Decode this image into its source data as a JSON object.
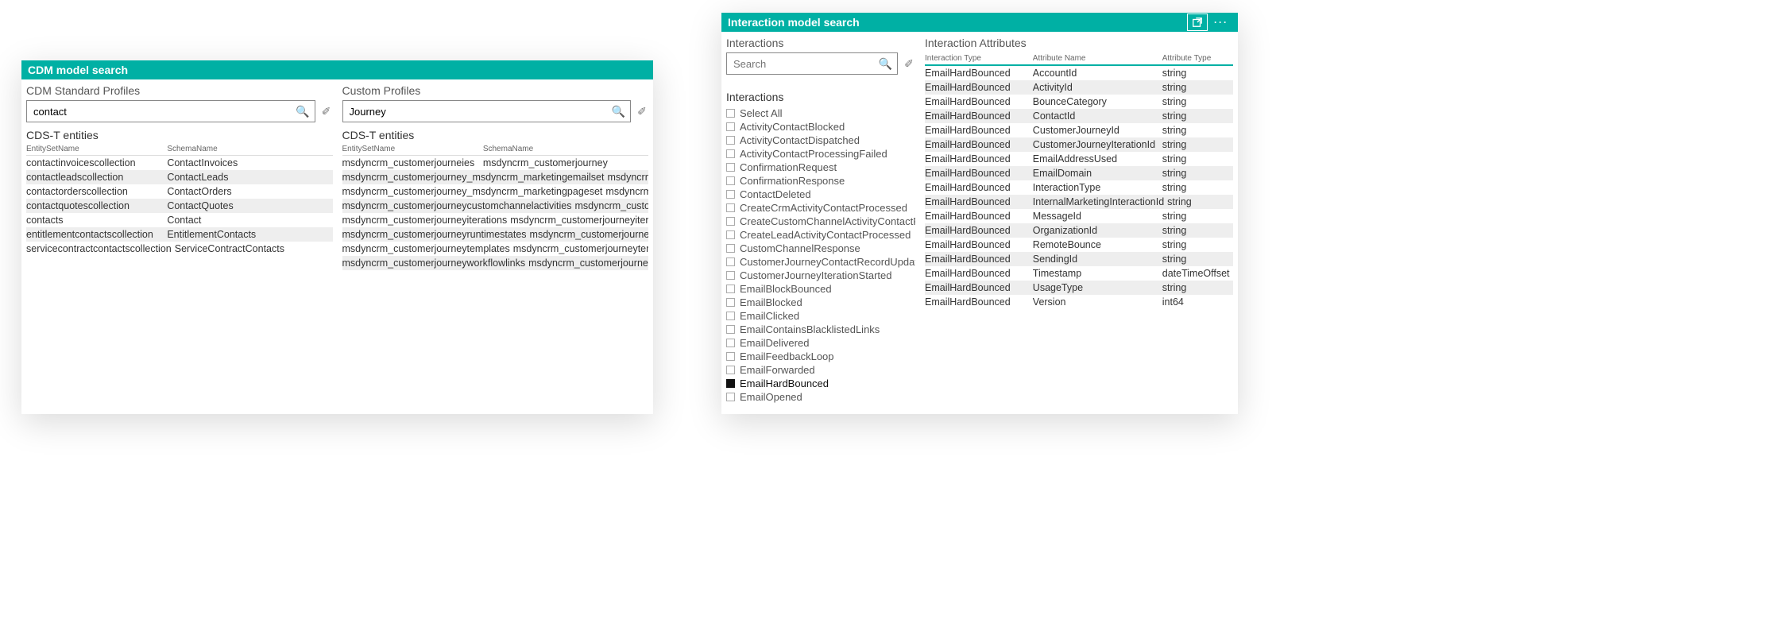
{
  "accent": "#00b0a4",
  "leftPanel": {
    "title": "CDM model search",
    "std": {
      "label": "CDM Standard Profiles",
      "searchValue": "contact",
      "searchPlaceholder": "",
      "tableTitle": "CDS-T entities",
      "headers": [
        "EntitySetName",
        "SchemaName"
      ],
      "rows": [
        [
          "contactinvoicescollection",
          "ContactInvoices"
        ],
        [
          "contactleadscollection",
          "ContactLeads"
        ],
        [
          "contactorderscollection",
          "ContactOrders"
        ],
        [
          "contactquotescollection",
          "ContactQuotes"
        ],
        [
          "contacts",
          "Contact"
        ],
        [
          "entitlementcontactscollection",
          "EntitlementContacts"
        ],
        [
          "servicecontractcontactscollection",
          "ServiceContractContacts"
        ]
      ]
    },
    "custom": {
      "label": "Custom Profiles",
      "searchValue": "Journey",
      "searchPlaceholder": "",
      "tableTitle": "CDS-T entities",
      "headers": [
        "EntitySetName",
        "SchemaName"
      ],
      "rows": [
        [
          "msdyncrm_customerjourneies",
          "msdyncrm_customerjourney"
        ],
        [
          "msdyncrm_customerjourney_msdyncrm_marketingemailset",
          "msdyncrm_customerjourney_msdyncrm_marketingemail"
        ],
        [
          "msdyncrm_customerjourney_msdyncrm_marketingpageset",
          "msdyncrm_customerjourney_msdyncrm_marketingpage"
        ],
        [
          "msdyncrm_customerjourneycustomchannelactivities",
          "msdyncrm_customerjourneycustomchannelactivity"
        ],
        [
          "msdyncrm_customerjourneyiterations",
          "msdyncrm_customerjourneyiteration"
        ],
        [
          "msdyncrm_customerjourneyruntimestates",
          "msdyncrm_customerjourneyruntimestate"
        ],
        [
          "msdyncrm_customerjourneytemplates",
          "msdyncrm_customerjourneytemplate"
        ],
        [
          "msdyncrm_customerjourneyworkflowlinks",
          "msdyncrm_customerjourneyworkflowlink"
        ]
      ]
    }
  },
  "rightPanel": {
    "title": "Interaction model search",
    "interactionsLabel": "Interactions",
    "searchValue": "",
    "searchPlaceholder": "Search",
    "listHeader": "Interactions",
    "items": [
      {
        "label": "Select All",
        "checked": false
      },
      {
        "label": "ActivityContactBlocked",
        "checked": false
      },
      {
        "label": "ActivityContactDispatched",
        "checked": false
      },
      {
        "label": "ActivityContactProcessingFailed",
        "checked": false
      },
      {
        "label": "ConfirmationRequest",
        "checked": false
      },
      {
        "label": "ConfirmationResponse",
        "checked": false
      },
      {
        "label": "ContactDeleted",
        "checked": false
      },
      {
        "label": "CreateCrmActivityContactProcessed",
        "checked": false
      },
      {
        "label": "CreateCustomChannelActivityContactProc...",
        "checked": false
      },
      {
        "label": "CreateLeadActivityContactProcessed",
        "checked": false
      },
      {
        "label": "CustomChannelResponse",
        "checked": false
      },
      {
        "label": "CustomerJourneyContactRecordUpdated",
        "checked": false
      },
      {
        "label": "CustomerJourneyIterationStarted",
        "checked": false
      },
      {
        "label": "EmailBlockBounced",
        "checked": false
      },
      {
        "label": "EmailBlocked",
        "checked": false
      },
      {
        "label": "EmailClicked",
        "checked": false
      },
      {
        "label": "EmailContainsBlacklistedLinks",
        "checked": false
      },
      {
        "label": "EmailDelivered",
        "checked": false
      },
      {
        "label": "EmailFeedbackLoop",
        "checked": false
      },
      {
        "label": "EmailForwarded",
        "checked": false
      },
      {
        "label": "EmailHardBounced",
        "checked": true
      },
      {
        "label": "EmailOpened",
        "checked": false
      }
    ],
    "attributes": {
      "label": "Interaction Attributes",
      "headers": [
        "Interaction Type",
        "Attribute Name",
        "Attribute Type"
      ],
      "rows": [
        [
          "EmailHardBounced",
          "AccountId",
          "string"
        ],
        [
          "EmailHardBounced",
          "ActivityId",
          "string"
        ],
        [
          "EmailHardBounced",
          "BounceCategory",
          "string"
        ],
        [
          "EmailHardBounced",
          "ContactId",
          "string"
        ],
        [
          "EmailHardBounced",
          "CustomerJourneyId",
          "string"
        ],
        [
          "EmailHardBounced",
          "CustomerJourneyIterationId",
          "string"
        ],
        [
          "EmailHardBounced",
          "EmailAddressUsed",
          "string"
        ],
        [
          "EmailHardBounced",
          "EmailDomain",
          "string"
        ],
        [
          "EmailHardBounced",
          "InteractionType",
          "string"
        ],
        [
          "EmailHardBounced",
          "InternalMarketingInteractionId",
          "string"
        ],
        [
          "EmailHardBounced",
          "MessageId",
          "string"
        ],
        [
          "EmailHardBounced",
          "OrganizationId",
          "string"
        ],
        [
          "EmailHardBounced",
          "RemoteBounce",
          "string"
        ],
        [
          "EmailHardBounced",
          "SendingId",
          "string"
        ],
        [
          "EmailHardBounced",
          "Timestamp",
          "dateTimeOffset"
        ],
        [
          "EmailHardBounced",
          "UsageType",
          "string"
        ],
        [
          "EmailHardBounced",
          "Version",
          "int64"
        ]
      ]
    }
  }
}
